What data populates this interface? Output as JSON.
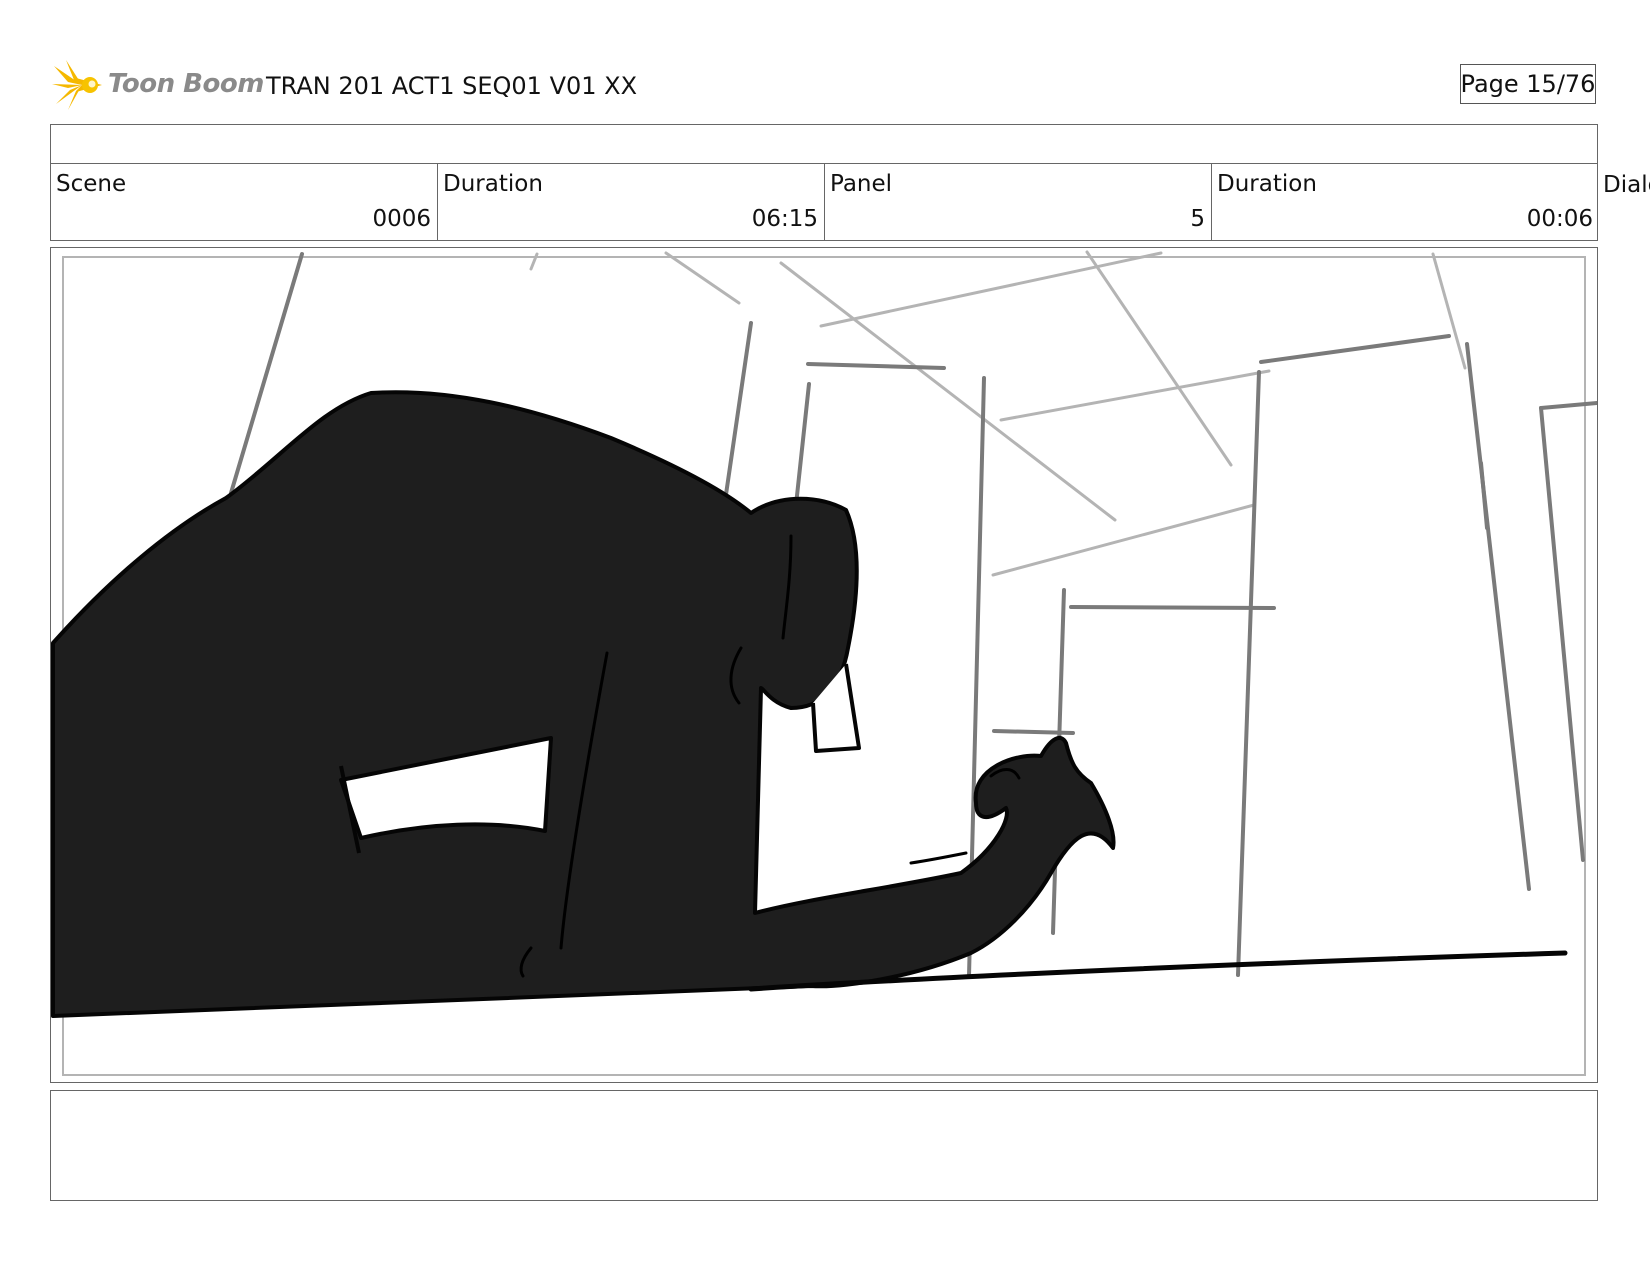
{
  "header": {
    "logo_text": "Toon Boom",
    "doc_title": "TRAN 201 ACT1 SEQ01 V01 XX",
    "page_label": "Page 15/76"
  },
  "info": {
    "scene_label": "Scene",
    "scene_value": "0006",
    "scene_duration_label": "Duration",
    "scene_duration_value": "06:15",
    "panel_label": "Panel",
    "panel_value": "5",
    "panel_duration_label": "Duration",
    "panel_duration_value": "00:06",
    "dialog_label": "Dialog"
  },
  "colors": {
    "logo_star": "#f5b800",
    "logo_text": "#8a8a8a",
    "silhouette": "#1e1e1e",
    "border": "#666666"
  }
}
